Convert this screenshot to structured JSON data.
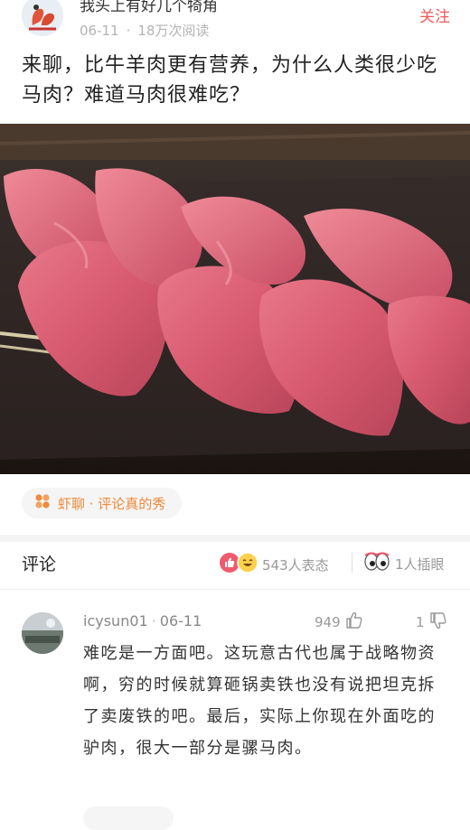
{
  "post": {
    "author": "我头上有好几个犄角",
    "date": "06-11",
    "views": "18万次阅读",
    "follow_label": "关注",
    "title": "来聊，比牛羊肉更有营养，为什么人类很少吃马肉？难道马肉很难吃？"
  },
  "topic": {
    "label": "虾聊 · 评论真的秀",
    "icon": "flower-icon",
    "accent": "#f08a3a"
  },
  "comments_header": {
    "title": "评论",
    "reactions_count": "543人表态",
    "peek_count": "1人插眼"
  },
  "comment": {
    "user": "icysun01",
    "date": "06-11",
    "likes": "949",
    "dislikes": "1",
    "body": "难吃是一方面吧。这玩意古代也属于战略物资啊，穷的时候就算砸锅卖铁也没有说把坦克拆了卖废铁的吧。最后，实际上你现在外面吃的驴肉，很大一部分是骡马肉。"
  },
  "colors": {
    "follow": "#f25a5a",
    "muted": "#999999",
    "like_red": "#f05a6e"
  }
}
